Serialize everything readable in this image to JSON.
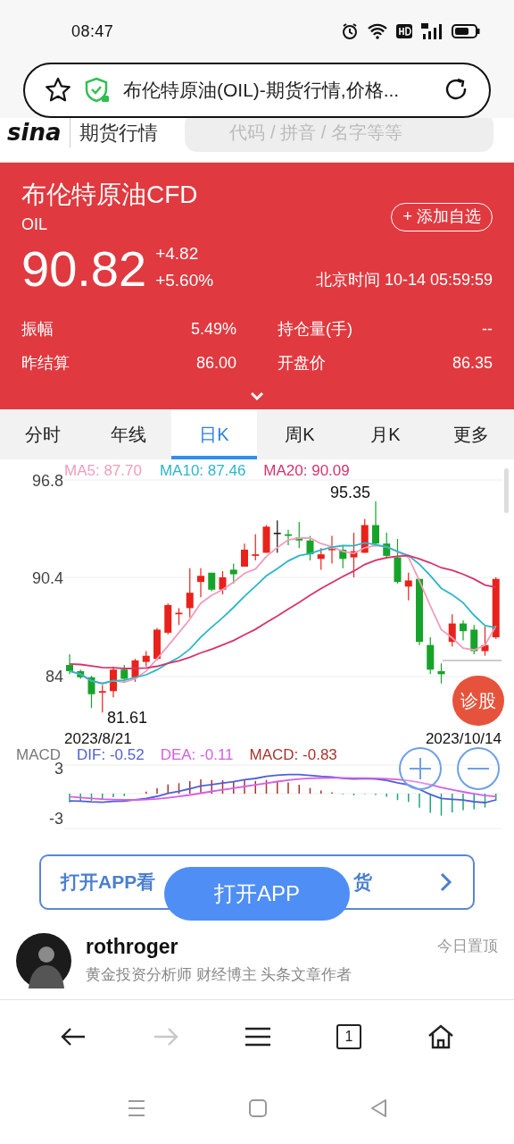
{
  "status_bar": {
    "time": "08:47"
  },
  "address_bar": {
    "title": "布伦特原油(OIL)-期货行情,价格..."
  },
  "site_header": {
    "logo": "sina",
    "section": "期货行情",
    "search_placeholder": "代码 / 拼音 / 名字等等"
  },
  "quote": {
    "name": "布伦特原油CFD",
    "code": "OIL",
    "add_button": "+ 添加自选",
    "price": "90.82",
    "change": "+4.82",
    "change_pct": "+5.60%",
    "time": "北京时间 10-14 05:59:59",
    "stats": [
      {
        "label": "振幅",
        "value": "5.49%"
      },
      {
        "label": "持仓量(手)",
        "value": "--"
      },
      {
        "label": "昨结算",
        "value": "86.00"
      },
      {
        "label": "开盘价",
        "value": "86.35"
      }
    ]
  },
  "tabs": [
    {
      "label": "分时",
      "selected": false
    },
    {
      "label": "年线",
      "selected": false
    },
    {
      "label": "日K",
      "selected": true
    },
    {
      "label": "周K",
      "selected": false
    },
    {
      "label": "月K",
      "selected": false
    },
    {
      "label": "更多",
      "selected": false
    }
  ],
  "kline": {
    "legend": [
      {
        "label": "MA5: 87.70",
        "color": "#f29cba"
      },
      {
        "label": "MA10: 87.46",
        "color": "#2bb6c8"
      },
      {
        "label": "MA20: 90.09",
        "color": "#d6336c"
      }
    ],
    "y_labels": [
      "96.8",
      "90.4",
      "84"
    ],
    "high_label": "95.35",
    "low_label": "81.61",
    "start_date": "2023/8/21",
    "end_date": "2023/10/14"
  },
  "macd": {
    "title": "MACD",
    "legend": [
      {
        "label": "DIF: -0.52",
        "color": "#4f5fd8"
      },
      {
        "label": "DEA: -0.11",
        "color": "#d65ee6"
      },
      {
        "label": "MACD: -0.83",
        "color": "#a8342c"
      }
    ],
    "y_labels": [
      "3",
      "-3"
    ]
  },
  "diagnose_button": "诊股",
  "promo_banner": {
    "text_left": "打开APP看",
    "text_right": "货"
  },
  "open_app_button": "打开APP",
  "author": {
    "name": "rothroger",
    "bio": "黄金投资分析师 财经博主 头条文章作者",
    "pin": "今日置顶"
  },
  "browser_nav": {
    "forward_disabled": true,
    "tab_count": "1"
  }
}
